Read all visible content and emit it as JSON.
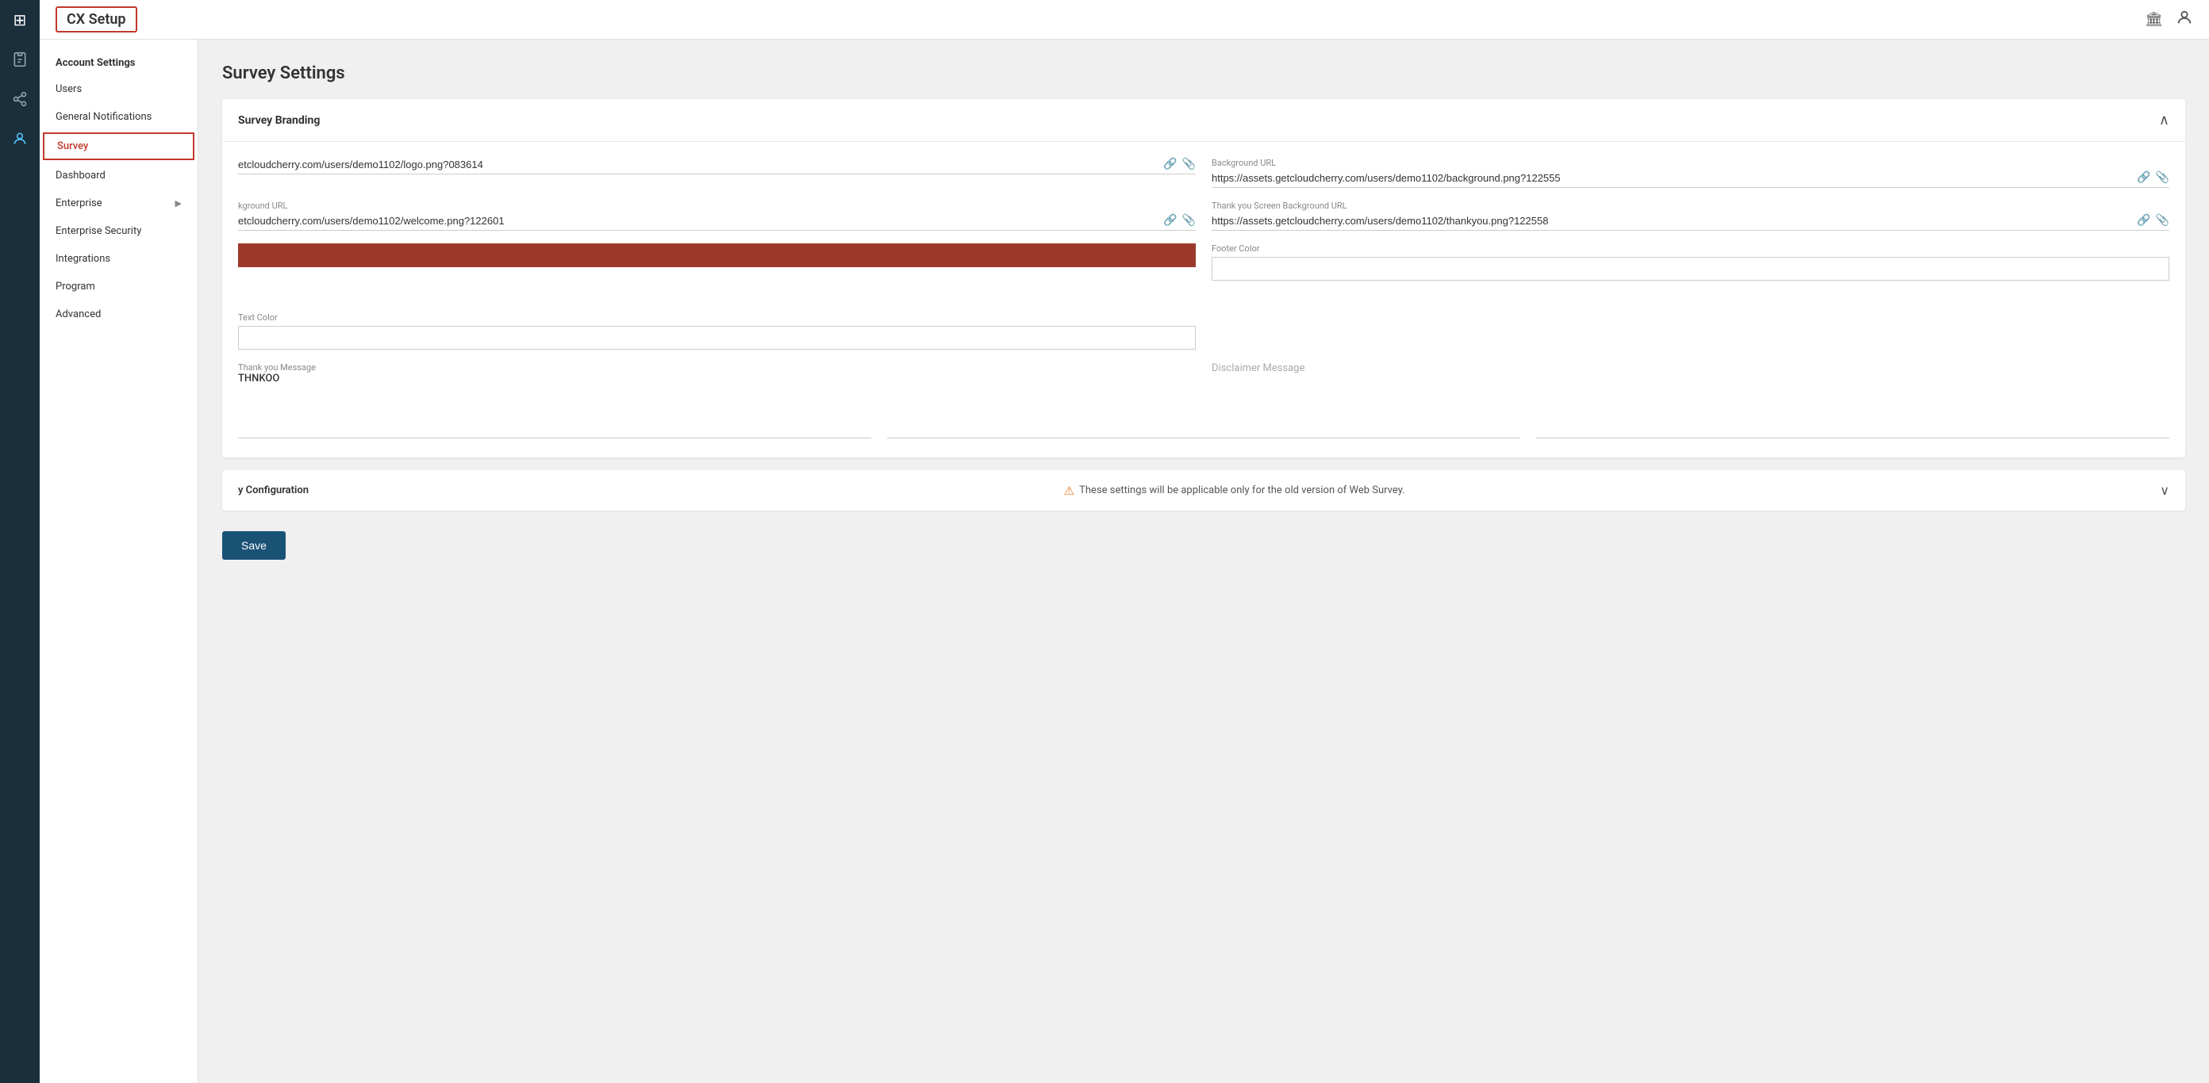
{
  "header": {
    "title": "CX Setup",
    "icons": {
      "building": "🏛",
      "user": "👤"
    }
  },
  "nav": {
    "icons": [
      {
        "name": "grid",
        "symbol": "⊞",
        "active": true
      },
      {
        "name": "clipboard",
        "symbol": "📋",
        "active": false
      },
      {
        "name": "share",
        "symbol": "↗",
        "active": false
      },
      {
        "name": "users",
        "symbol": "👥",
        "active": true
      }
    ]
  },
  "sidebar": {
    "section_title": "Account Settings",
    "items": [
      {
        "label": "Users",
        "active": false,
        "has_chevron": false
      },
      {
        "label": "General Notifications",
        "active": false,
        "has_chevron": false
      },
      {
        "label": "Survey",
        "active": true,
        "has_chevron": false
      },
      {
        "label": "Dashboard",
        "active": false,
        "has_chevron": false
      },
      {
        "label": "Enterprise",
        "active": false,
        "has_chevron": true
      },
      {
        "label": "Enterprise Security",
        "active": false,
        "has_chevron": false
      },
      {
        "label": "Integrations",
        "active": false,
        "has_chevron": false
      },
      {
        "label": "Program",
        "active": false,
        "has_chevron": false
      },
      {
        "label": "Advanced",
        "active": false,
        "has_chevron": false
      }
    ]
  },
  "page": {
    "title": "Survey Settings",
    "branding_card": {
      "title": "Survey Branding",
      "fields": {
        "logo_url": {
          "label": "",
          "value": "etcloudcherry.com/users/demo1102/logo.png?083614"
        },
        "background_url": {
          "label": "Background URL",
          "value": "https://assets.getcloudcherry.com/users/demo1102/background.png?122555"
        },
        "welcome_url": {
          "label": "kground URL",
          "value": "etcloudcherry.com/users/demo1102/welcome.png?122601"
        },
        "thankyou_bg_url": {
          "label": "Thank you Screen Background URL",
          "value": "https://assets.getcloudcherry.com/users/demo1102/thankyou.png?122558"
        },
        "footer_color_label": "Footer Color",
        "text_color_label": "Text Color",
        "thankyou_message_label": "Thank you Message",
        "thankyou_message_value": "THNKOO",
        "disclaimer_message_label": "Disclaimer Message"
      }
    },
    "configuration_card": {
      "title": "y Configuration",
      "warning": "These settings will be applicable only for the old version of Web Survey."
    },
    "save_label": "Save"
  }
}
